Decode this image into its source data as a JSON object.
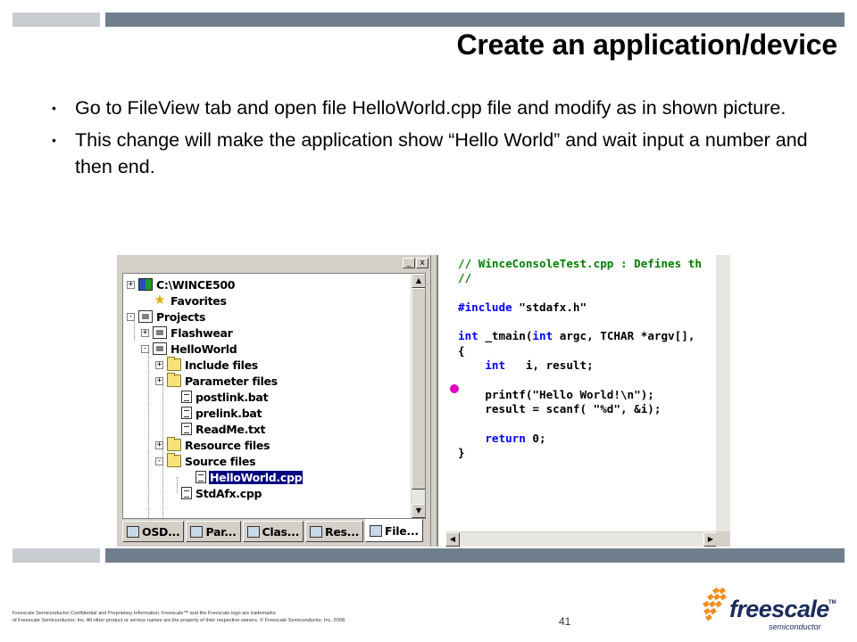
{
  "slide": {
    "title": "Create an application/device",
    "bullets": [
      "Go to FileView tab and open file HelloWorld.cpp file and modify as in shown picture.",
      "This change will make the application show “Hello World” and wait input a number and then end."
    ],
    "bullet_glyph": "•",
    "page_number": "41",
    "footer_line1": "Freescale Semiconductor Confidential and Proprietary Information. Freescale™ and the Freescale logo are trademarks",
    "footer_line2": "of Freescale Semiconductor, Inc. All other product or service names are the property of their respective owners. © Freescale Semiconductor, Inc. 2008.",
    "logo_text": "freescale",
    "logo_tm": "TM",
    "logo_sub": "semiconductor",
    "colors": {
      "bar_dark": "#6f7f8e",
      "bar_light": "#c8ccd1",
      "logo_navy": "#1a2a5c",
      "logo_orange": "#f28c1e"
    }
  },
  "fileview": {
    "window_buttons": [
      "_",
      "x"
    ],
    "tree": [
      {
        "label": "C:\\WINCE500",
        "expander": "+",
        "icon": "workspace-icon"
      },
      {
        "label": "Favorites",
        "expander": "",
        "icon": "star-icon"
      },
      {
        "label": "Projects",
        "expander": "-",
        "icon": "projects-icon"
      },
      {
        "label": "Flashwear",
        "expander": "+",
        "icon": "project-icon"
      },
      {
        "label": "HelloWorld",
        "expander": "-",
        "icon": "project-icon"
      },
      {
        "label": "Include files",
        "expander": "+",
        "icon": "folder-icon"
      },
      {
        "label": "Parameter files",
        "expander": "+",
        "icon": "folder-icon"
      },
      {
        "label": "postlink.bat",
        "expander": "",
        "icon": "file-icon"
      },
      {
        "label": "prelink.bat",
        "expander": "",
        "icon": "file-icon"
      },
      {
        "label": "ReadMe.txt",
        "expander": "",
        "icon": "file-icon"
      },
      {
        "label": "Resource files",
        "expander": "+",
        "icon": "folder-icon"
      },
      {
        "label": "Source files",
        "expander": "-",
        "icon": "folder-icon"
      },
      {
        "label": "HelloWorld.cpp",
        "expander": "",
        "icon": "file-icon",
        "selected": true
      },
      {
        "label": "StdAfx.cpp",
        "expander": "",
        "icon": "file-icon"
      }
    ],
    "tabs": [
      "OSD...",
      "Par...",
      "Clas...",
      "Res...",
      "File..."
    ],
    "active_tab": "File..."
  },
  "editor": {
    "lines": [
      {
        "type": "cm",
        "text": "// WinceConsoleTest.cpp : Defines th"
      },
      {
        "type": "cm",
        "text": "//"
      },
      {
        "type": "blank",
        "text": ""
      },
      {
        "type": "mixed",
        "parts": [
          {
            "k": "kw",
            "t": "#include"
          },
          {
            "k": "n",
            "t": " \"stdafx.h\""
          }
        ]
      },
      {
        "type": "blank",
        "text": ""
      },
      {
        "type": "mixed",
        "parts": [
          {
            "k": "kw",
            "t": "int"
          },
          {
            "k": "n",
            "t": " _tmain("
          },
          {
            "k": "kw",
            "t": "int"
          },
          {
            "k": "n",
            "t": " argc, TCHAR *argv[],"
          }
        ]
      },
      {
        "type": "plain",
        "text": "{"
      },
      {
        "type": "mixed",
        "parts": [
          {
            "k": "n",
            "t": "    "
          },
          {
            "k": "kw",
            "t": "int"
          },
          {
            "k": "n",
            "t": "   i, result;"
          }
        ]
      },
      {
        "type": "blank",
        "text": ""
      },
      {
        "type": "plain",
        "text": "    printf(\"Hello World!\\n\");"
      },
      {
        "type": "plain",
        "text": "    result = scanf( \"%d\", &i);"
      },
      {
        "type": "blank",
        "text": ""
      },
      {
        "type": "mixed",
        "parts": [
          {
            "k": "n",
            "t": "    "
          },
          {
            "k": "kw",
            "t": "return"
          },
          {
            "k": "n",
            "t": " 0;"
          }
        ]
      },
      {
        "type": "plain",
        "text": "}"
      }
    ]
  }
}
